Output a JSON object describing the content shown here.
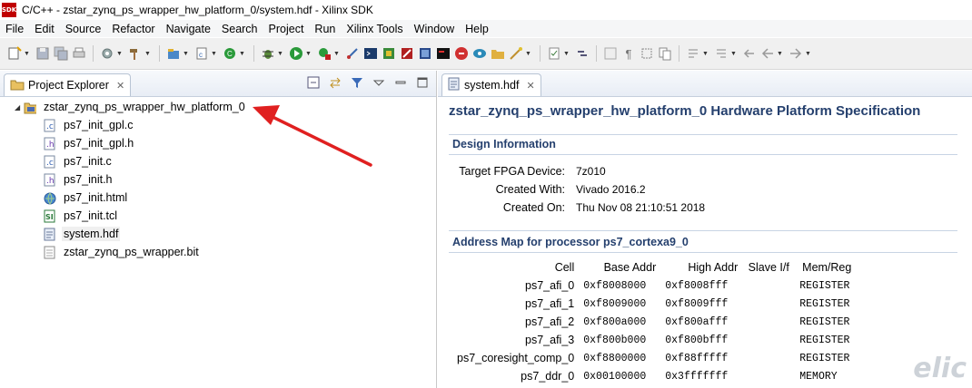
{
  "window": {
    "title": "C/C++ - zstar_zynq_ps_wrapper_hw_platform_0/system.hdf - Xilinx SDK",
    "logo_text": "SDK"
  },
  "menu": [
    "File",
    "Edit",
    "Source",
    "Refactor",
    "Navigate",
    "Search",
    "Project",
    "Run",
    "Xilinx Tools",
    "Window",
    "Help"
  ],
  "project_explorer": {
    "tab_label": "Project Explorer",
    "tab_close": "✕",
    "root": {
      "label": "zstar_zynq_ps_wrapper_hw_platform_0"
    },
    "files": [
      {
        "label": "ps7_init_gpl.c",
        "icon": "c-file-icon"
      },
      {
        "label": "ps7_init_gpl.h",
        "icon": "h-file-icon"
      },
      {
        "label": "ps7_init.c",
        "icon": "c-file-icon"
      },
      {
        "label": "ps7_init.h",
        "icon": "h-file-icon"
      },
      {
        "label": "ps7_init.html",
        "icon": "html-file-icon"
      },
      {
        "label": "ps7_init.tcl",
        "icon": "tcl-file-icon"
      },
      {
        "label": "system.hdf",
        "icon": "hdf-file-icon"
      },
      {
        "label": "zstar_zynq_ps_wrapper.bit",
        "icon": "bit-file-icon"
      }
    ]
  },
  "editor": {
    "tab_label": "system.hdf",
    "tab_close": "✕",
    "title": "zstar_zynq_ps_wrapper_hw_platform_0 Hardware Platform Specification",
    "design_info": {
      "heading": "Design Information",
      "rows": [
        {
          "key": "Target FPGA Device:",
          "value": "7z010"
        },
        {
          "key": "Created With:",
          "value": "Vivado 2016.2"
        },
        {
          "key": "Created On:",
          "value": "Thu Nov 08 21:10:51 2018"
        }
      ]
    },
    "address_map": {
      "heading": "Address Map for processor ps7_cortexa9_0",
      "columns": [
        "Cell",
        "Base Addr",
        "High Addr",
        "Slave I/f",
        "Mem/Reg"
      ],
      "rows": [
        [
          "ps7_afi_0",
          "0xf8008000",
          "0xf8008fff",
          "",
          "REGISTER"
        ],
        [
          "ps7_afi_1",
          "0xf8009000",
          "0xf8009fff",
          "",
          "REGISTER"
        ],
        [
          "ps7_afi_2",
          "0xf800a000",
          "0xf800afff",
          "",
          "REGISTER"
        ],
        [
          "ps7_afi_3",
          "0xf800b000",
          "0xf800bfff",
          "",
          "REGISTER"
        ],
        [
          "ps7_coresight_comp_0",
          "0xf8800000",
          "0xf88fffff",
          "",
          "REGISTER"
        ],
        [
          "ps7_ddr_0",
          "0x00100000",
          "0x3fffffff",
          "",
          "MEMORY"
        ]
      ]
    }
  },
  "watermark": "elic",
  "colors": {
    "heading": "#25406e",
    "arrow": "#e02020"
  }
}
